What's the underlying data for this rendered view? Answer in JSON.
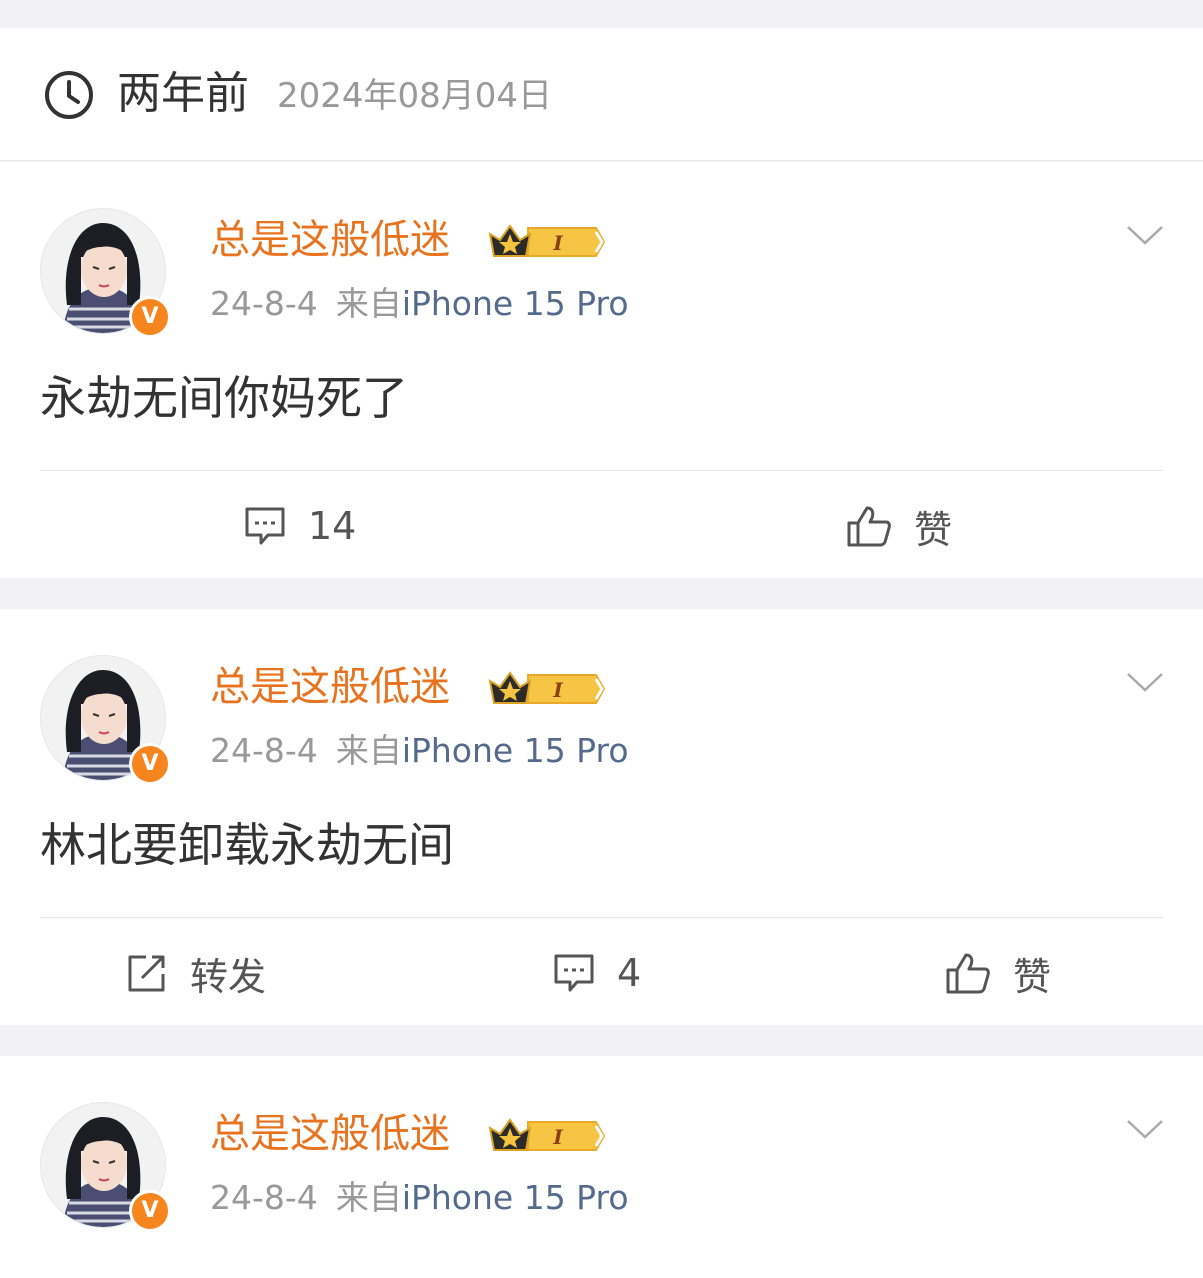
{
  "header": {
    "label": "两年前",
    "date": "2024年08月04日"
  },
  "posts": [
    {
      "username": "总是这般低迷",
      "level_badge": "I",
      "date": "24-8-4",
      "source_prefix": "来自",
      "device": "iPhone 15 Pro",
      "content": "永劫无间你妈死了",
      "actions": {
        "comments": "14",
        "like": "赞"
      }
    },
    {
      "username": "总是这般低迷",
      "level_badge": "I",
      "date": "24-8-4",
      "source_prefix": "来自",
      "device": "iPhone 15 Pro",
      "content": "林北要卸载永劫无间",
      "actions": {
        "repost": "转发",
        "comments": "4",
        "like": "赞"
      }
    },
    {
      "username": "总是这般低迷",
      "level_badge": "I",
      "date": "24-8-4",
      "source_prefix": "来自",
      "device": "iPhone 15 Pro"
    }
  ],
  "verified_badge": "V",
  "colors": {
    "username": "#e8731f",
    "device": "#546b8e",
    "verified": "#f7851e"
  }
}
